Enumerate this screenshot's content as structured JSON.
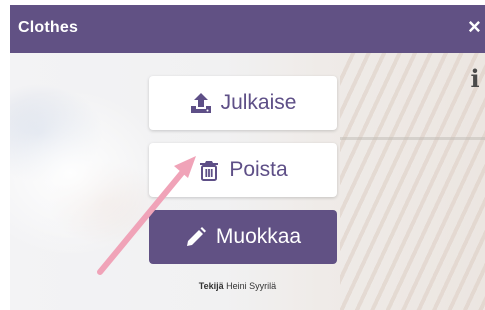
{
  "window": {
    "title": "Clothes",
    "close_glyph": "×"
  },
  "info_glyph": "i",
  "buttons": {
    "publish": {
      "label": "Julkaise",
      "icon": "upload-icon"
    },
    "delete": {
      "label": "Poista",
      "icon": "trash-icon"
    },
    "edit": {
      "label": "Muokkaa",
      "icon": "pencil-icon"
    }
  },
  "author": {
    "prefix": "Tekijä",
    "name": "Heini Syyrilä"
  },
  "colors": {
    "brand": "#615184",
    "arrow": "#f0a3b8",
    "text_purple": "#5e4f87"
  }
}
